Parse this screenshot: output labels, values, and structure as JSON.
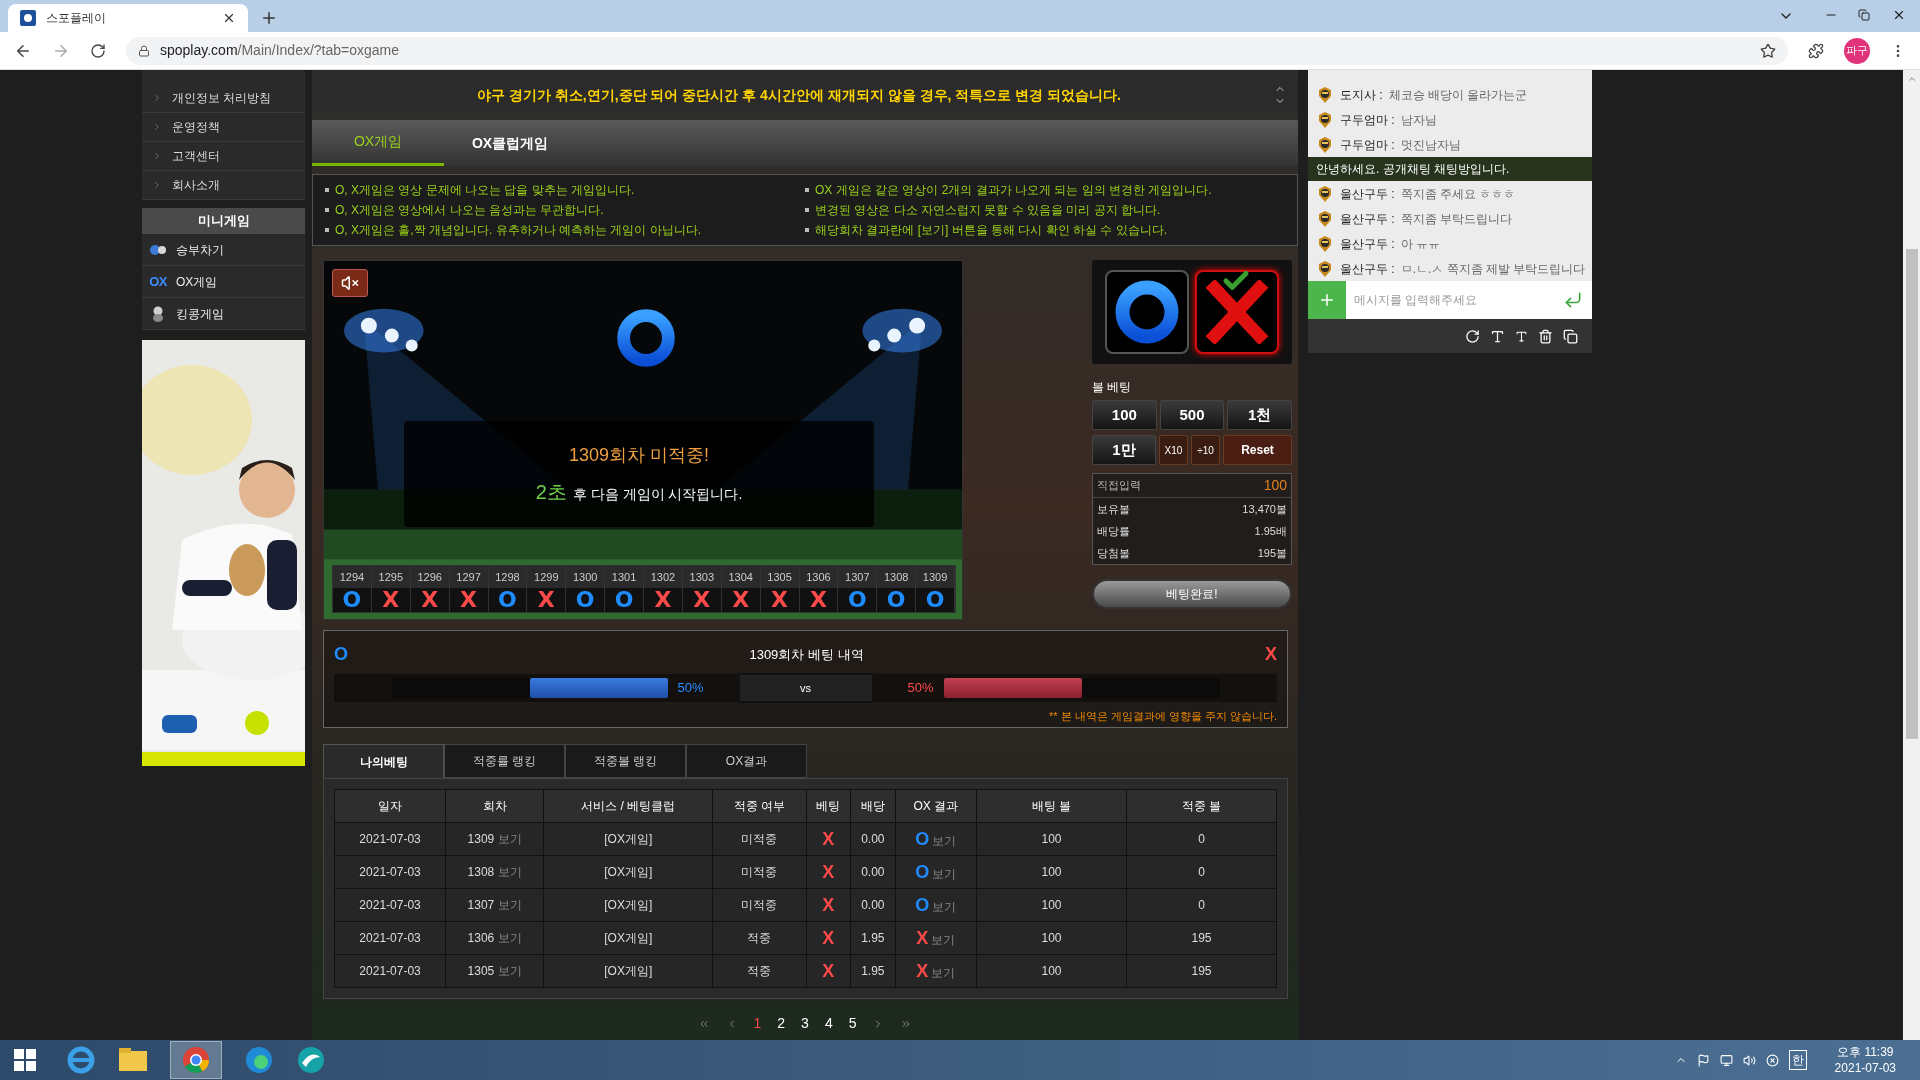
{
  "browser": {
    "tab_title": "스포플레이",
    "url_host": "spoplay.com",
    "url_path": "/Main/Index/?tab=oxgame",
    "profile": "파구"
  },
  "sidebar": {
    "links": [
      "개인정보 처리방침",
      "운영정책",
      "고객센터",
      "회사소개"
    ],
    "section_title": "미니게임",
    "games": [
      {
        "label": "승부차기",
        "kind": "ball"
      },
      {
        "label": "OX게임",
        "kind": "ox",
        "icon_text": "OX"
      },
      {
        "label": "킹콩게임",
        "kind": "gorilla"
      }
    ]
  },
  "notice": "야구 경기가 취소,연기,중단 되어 중단시간 후 4시간안에 재개되지 않을 경우, 적특으로 변경 되었습니다.",
  "tabs": [
    {
      "label": "OX게임",
      "selected": true
    },
    {
      "label": "OX클럽게임",
      "selected": false
    }
  ],
  "rules": {
    "left": [
      "O, X게임은 영상 문제에 나오는 답을 맞추는 게임입니다.",
      "O, X게임은 영상에서 나오는 음성과는 무관합니다.",
      "O, X게임은 홀,짝 개념입니다. 유추하거나 예측하는 게임이 아닙니다."
    ],
    "right": [
      "OX 게임은 같은 영상이 2개의 결과가 나오게 되는 임의 변경한 게임입니다.",
      "변경된 영상은 다소 자연스럽지 못할 수 있음을 미리 공지 합니다.",
      "해당회차 결과란에 [보기] 버튼을 통해 다시 확인 하실 수 있습니다."
    ]
  },
  "game": {
    "muted": true,
    "message": "1309회차 미적중!",
    "countdown": "2초",
    "countdown_suffix": "후 다음 게임이 시작됩니다.",
    "history": [
      {
        "round": "1294",
        "result": "O",
        "color": "#1e8cff"
      },
      {
        "round": "1295",
        "result": "X",
        "color": "#ff4a4a"
      },
      {
        "round": "1296",
        "result": "X",
        "color": "#ff4a4a"
      },
      {
        "round": "1297",
        "result": "X",
        "color": "#ff4a4a"
      },
      {
        "round": "1298",
        "result": "O",
        "color": "#1e8cff"
      },
      {
        "round": "1299",
        "result": "X",
        "color": "#ff4a4a"
      },
      {
        "round": "1300",
        "result": "O",
        "color": "#1e8cff"
      },
      {
        "round": "1301",
        "result": "O",
        "color": "#1e8cff"
      },
      {
        "round": "1302",
        "result": "X",
        "color": "#ff4a4a"
      },
      {
        "round": "1303",
        "result": "X",
        "color": "#ff4a4a"
      },
      {
        "round": "1304",
        "result": "X",
        "color": "#ff4a4a"
      },
      {
        "round": "1305",
        "result": "X",
        "color": "#ff4a4a"
      },
      {
        "round": "1306",
        "result": "X",
        "color": "#ff4a4a"
      },
      {
        "round": "1307",
        "result": "O",
        "color": "#1e8cff"
      },
      {
        "round": "1308",
        "result": "O",
        "color": "#1e8cff"
      },
      {
        "round": "1309",
        "result": "O",
        "color": "#1e8cff"
      }
    ]
  },
  "bet_panel": {
    "choices": [
      {
        "kind": "o",
        "selected": false
      },
      {
        "kind": "x",
        "selected": true
      }
    ],
    "title": "볼 베팅",
    "chips": [
      "100",
      "500",
      "1천",
      "1만"
    ],
    "multipliers": [
      "X10",
      "÷10"
    ],
    "reset": "Reset",
    "direct_input": {
      "label": "직접입력",
      "value": "100"
    },
    "stats": [
      {
        "label": "보유볼",
        "value": "13,470볼"
      },
      {
        "label": "배당률",
        "value": "1.95배"
      },
      {
        "label": "당첨볼",
        "value": "195볼"
      }
    ],
    "submit": "베팅완료!"
  },
  "bet_stats": {
    "title": "1309회차 베팅 내역",
    "o_label": "O",
    "x_label": "X",
    "o": {
      "percent": "50%",
      "level": 0.5
    },
    "x": {
      "percent": "50%",
      "level": 0.5
    },
    "vs": "vs",
    "note": "** 본 내역은 게임결과에 영향을 주지 않습니다."
  },
  "history_tabs": [
    {
      "label": "나의베팅",
      "selected": true
    },
    {
      "label": "적중률 랭킹",
      "selected": false
    },
    {
      "label": "적중볼 랭킹",
      "selected": false
    },
    {
      "label": "OX결과",
      "selected": false
    }
  ],
  "table": {
    "columns": [
      "일자",
      "회차",
      "서비스 / 베팅클럽",
      "적중 여부",
      "베팅",
      "배당",
      "OX 결과",
      "배팅 볼",
      "적중 볼"
    ],
    "rows": [
      {
        "date": "2021-07-03",
        "round": "1309",
        "view": "보기",
        "service": "[OX게임]",
        "hit": "미적중",
        "bet": {
          "text": "X",
          "color": "#ff4a4a"
        },
        "odds": "0.00",
        "ox": {
          "text": "O",
          "color": "#1e8cff"
        },
        "ox_view": "보기",
        "amount": "100",
        "win": "0"
      },
      {
        "date": "2021-07-03",
        "round": "1308",
        "view": "보기",
        "service": "[OX게임]",
        "hit": "미적중",
        "bet": {
          "text": "X",
          "color": "#ff4a4a"
        },
        "odds": "0.00",
        "ox": {
          "text": "O",
          "color": "#1e8cff"
        },
        "ox_view": "보기",
        "amount": "100",
        "win": "0"
      },
      {
        "date": "2021-07-03",
        "round": "1307",
        "view": "보기",
        "service": "[OX게임]",
        "hit": "미적중",
        "bet": {
          "text": "X",
          "color": "#ff4a4a"
        },
        "odds": "0.00",
        "ox": {
          "text": "O",
          "color": "#1e8cff"
        },
        "ox_view": "보기",
        "amount": "100",
        "win": "0"
      },
      {
        "date": "2021-07-03",
        "round": "1306",
        "view": "보기",
        "service": "[OX게임]",
        "hit": "적중",
        "bet": {
          "text": "X",
          "color": "#ff4a4a"
        },
        "odds": "1.95",
        "ox": {
          "text": "X",
          "color": "#ff4a4a"
        },
        "ox_view": "보기",
        "amount": "100",
        "win": "195"
      },
      {
        "date": "2021-07-03",
        "round": "1305",
        "view": "보기",
        "service": "[OX게임]",
        "hit": "적중",
        "bet": {
          "text": "X",
          "color": "#ff4a4a"
        },
        "odds": "1.95",
        "ox": {
          "text": "X",
          "color": "#ff4a4a"
        },
        "ox_view": "보기",
        "amount": "100",
        "win": "195"
      }
    ]
  },
  "pagination": [
    {
      "label": "1",
      "selected": true
    },
    {
      "label": "2",
      "selected": false
    },
    {
      "label": "3",
      "selected": false
    },
    {
      "label": "4",
      "selected": false
    },
    {
      "label": "5",
      "selected": false
    }
  ],
  "chat": {
    "messages": [
      {
        "kind": "user",
        "user": "도지사 :",
        "text": "체코승 배당이 올라가는군"
      },
      {
        "kind": "user",
        "user": "구두엄마 :",
        "text": "남자님"
      },
      {
        "kind": "user",
        "user": "구두엄마 :",
        "text": "멋진남자님"
      },
      {
        "kind": "notice",
        "text": "안녕하세요. 공개채팅 채팅방입니다."
      },
      {
        "kind": "user",
        "user": "울산구두 :",
        "text": "쪽지좀 주세요 ㅎㅎㅎ"
      },
      {
        "kind": "user",
        "user": "울산구두 :",
        "text": "쪽지좀 부탁드립니다"
      },
      {
        "kind": "user",
        "user": "울산구두 :",
        "text": "아 ㅠㅠ"
      },
      {
        "kind": "user",
        "user": "울산구두 :",
        "text": "ㅁ.ㄴ.ㅅ 쪽지좀 제발 부탁드립니다"
      }
    ],
    "placeholder": "메시지를 입력해주세요"
  },
  "taskbar": {
    "ime": "한",
    "time": "오후 11:39",
    "date": "2021-07-03"
  }
}
